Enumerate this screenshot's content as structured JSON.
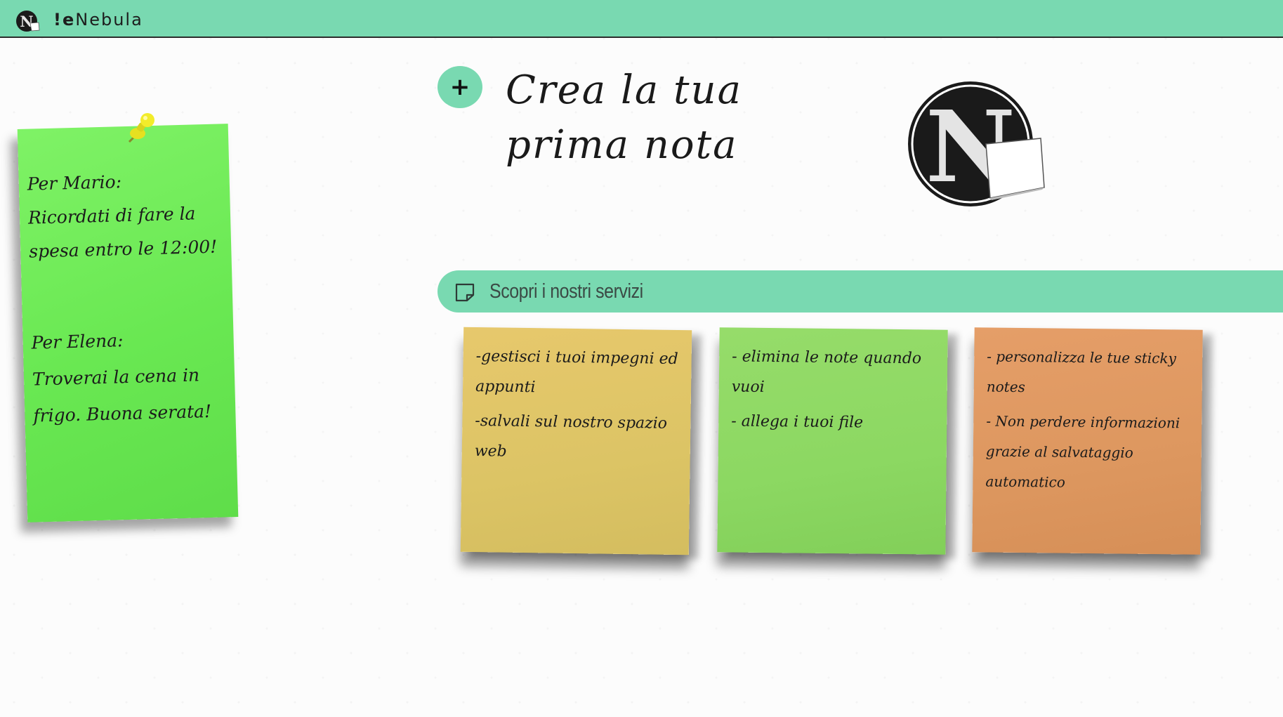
{
  "header": {
    "brand_prefix": "!e",
    "brand_suffix": "Nebula",
    "logo_letter": "N",
    "background_color": "#79d9b1"
  },
  "pinned_note": {
    "first_message": "Per Mario:\nRicordati di fare la\nspesa entro le 12:00!",
    "second_message": "Per Elena:\nTroverai la cena in\nfrigo. Buona serata!",
    "color": "#6cea55"
  },
  "create_note": {
    "button_symbol": "+",
    "title_line1": "Crea la tua",
    "title_line2": "prima nota"
  },
  "big_logo": {
    "letter": "N"
  },
  "services": {
    "label": "Scopri i nostri servizi",
    "icon": "note-icon"
  },
  "sticky_notes": [
    {
      "color": "#dcc465",
      "lines": [
        "-gestisci i tuoi impegni ed appunti",
        "-salvali sul nostro spazio web"
      ]
    },
    {
      "color": "#8cd862",
      "lines": [
        "- elimina le note quando vuoi",
        "- allega i tuoi file"
      ]
    },
    {
      "color": "#dd975f",
      "lines": [
        "- personalizza le tue sticky notes",
        "- Non perdere informazioni grazie al salvataggio automatico"
      ]
    }
  ]
}
